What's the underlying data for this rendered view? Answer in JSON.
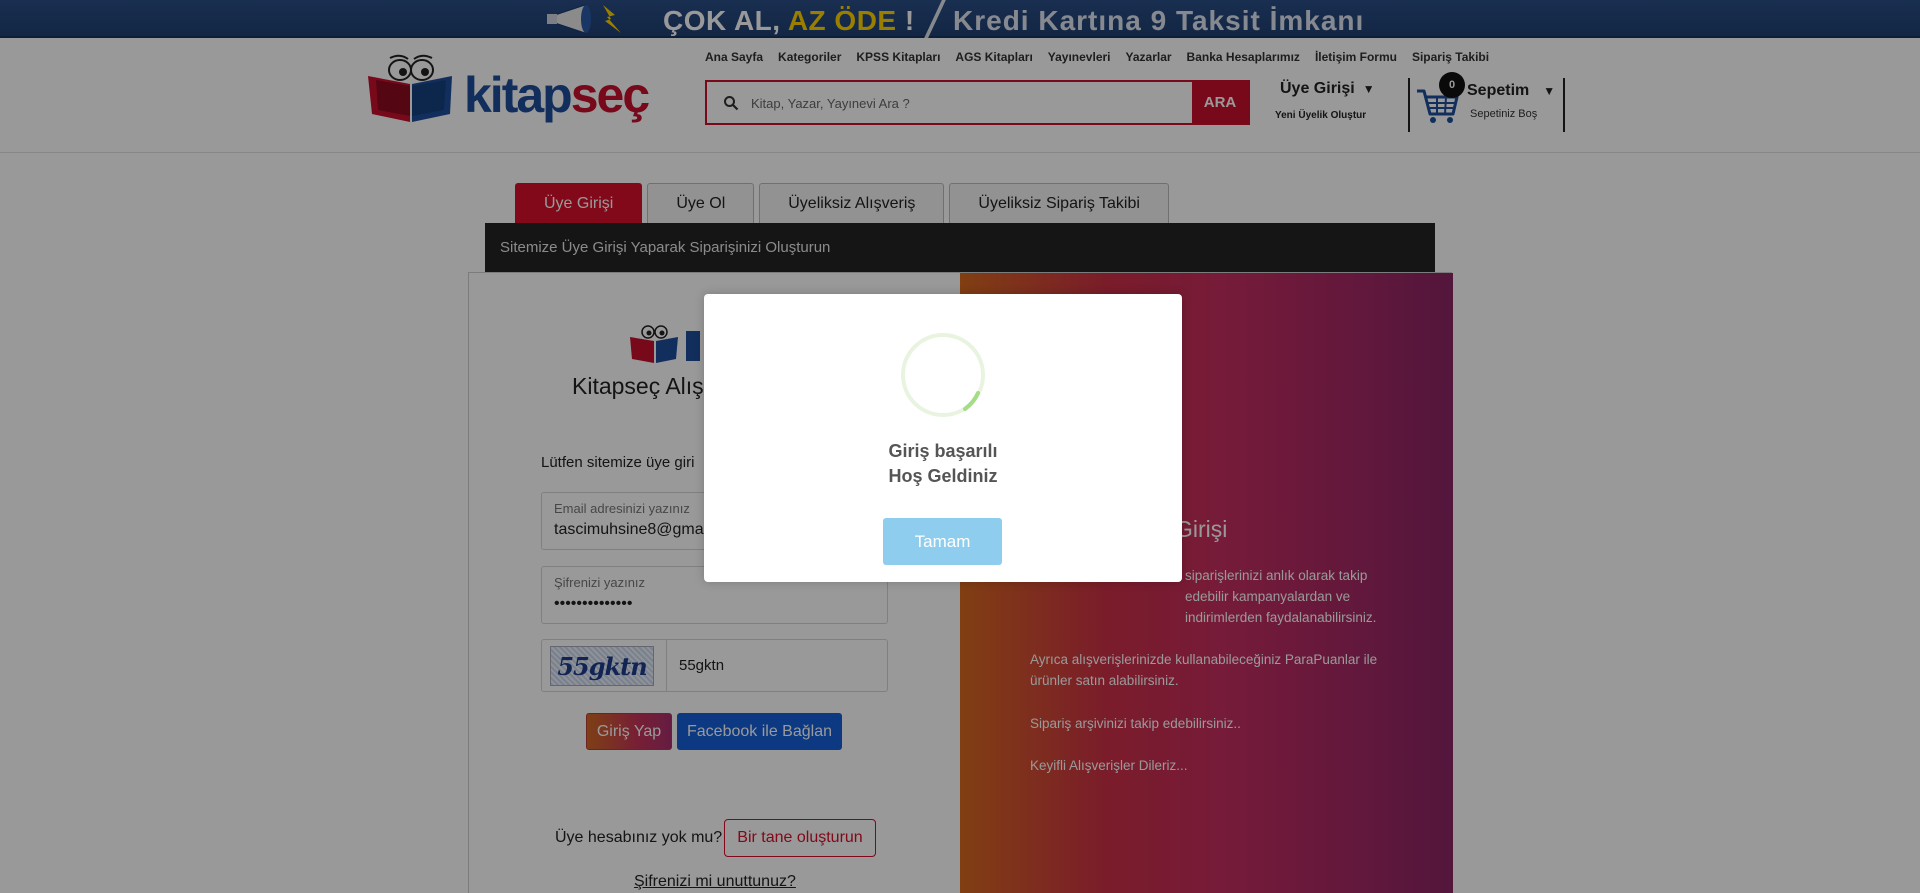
{
  "promo": {
    "left_white": "ÇOK AL, ",
    "left_yellow": "AZ ÖDE",
    "left_excl": " !",
    "right": "Kredi Kartına 9 Taksit İmkanı"
  },
  "brand": {
    "part1": "kitap",
    "part2": "seç"
  },
  "topnav": [
    "Ana Sayfa",
    "Kategoriler",
    "KPSS Kitapları",
    "AGS Kitapları",
    "Yayınevleri",
    "Yazarlar",
    "Banka Hesaplarımız",
    "İletişim Formu",
    "Sipariş Takibi"
  ],
  "search": {
    "placeholder": "Kitap, Yazar, Yayınevi Ara ?",
    "button": "ARA"
  },
  "account": {
    "title": "Üye Girişi",
    "caret": "▼",
    "sub": "Yeni Üyelik Oluştur"
  },
  "cart": {
    "count": "0",
    "title": "Sepetim",
    "caret": "▼",
    "sub": "Sepetiniz Boş"
  },
  "tabs": [
    "Üye Girişi",
    "Üye Ol",
    "Üyeliksiz Alışveriş",
    "Üyeliksiz Sipariş Takibi"
  ],
  "darkbar": "Sitemize Üye Girişi Yaparak Siparişinizi Oluşturun",
  "left": {
    "title_visible": "Kitapseç Alış",
    "prompt": "Lütfen sitemize üye giri",
    "email_label": "Email adresinizi yazınız",
    "email_value": "tascimuhsine8@gmai",
    "password_label": "Şifrenizi yazınız",
    "password_value": "••••••••••••••",
    "captcha_image_text": "55gktn",
    "captcha_value": "55gktn",
    "login_button": "Giriş Yap",
    "facebook_button": "Facebook ile Bağlan",
    "no_account": "Üye hesabınız yok mu?",
    "create_button": "Bir tane oluşturun",
    "forgot": "Şifrenizi mi unuttunuz?"
  },
  "right": {
    "title_visible": "Girişi",
    "p1_visible": "siparişlerinizi anlık olarak takip edebilir kampanyalardan ve indirimlerden faydalanabilirsiniz.",
    "p2": "Ayrıca alışverişlerinizde kullanabileceğiniz ParaPuanlar ile ürünler satın alabilirsiniz.",
    "p3": "Sipariş arşivinizi takip edebilirsiniz..",
    "p4": "Keyifli Alışverişler Dileriz..."
  },
  "modal": {
    "line1": "Giriş başarılı",
    "line2": "Hoş Geldiniz",
    "button": "Tamam"
  },
  "colors": {
    "accent": "#d8102a",
    "brand_blue": "#1f4e9c",
    "facebook": "#1560d9",
    "modal_button": "#8fcdee"
  },
  "icons": {
    "search": "search-icon",
    "cart": "cart-icon",
    "spinner": "loading-spinner-icon",
    "megaphone": "megaphone-icon"
  }
}
